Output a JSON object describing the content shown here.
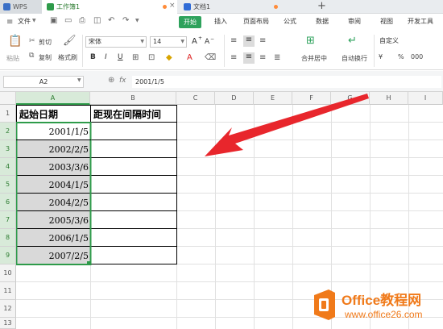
{
  "app": {
    "wps_tab": "WPS",
    "workbook_tab": "工作簿1",
    "doc_tab": "文档1",
    "new_tab_plus": "+"
  },
  "menu": {
    "file": "文件",
    "start": "开始",
    "insert": "插入",
    "page_layout": "页面布局",
    "formula": "公式",
    "data": "数据",
    "review": "审阅",
    "view": "视图",
    "dev_tools": "开发工具"
  },
  "toolbar": {
    "cut": "剪切",
    "copy": "复制",
    "format_painter": "格式刷",
    "paste": "粘贴",
    "font_name": "宋体",
    "font_size": "14",
    "bold": "B",
    "italic": "I",
    "underline": "U",
    "grow_font": "A",
    "shrink_font": "A",
    "merge_center": "合并居中",
    "auto_wrap": "自动换行",
    "number_format": "自定义",
    "currency": "¥",
    "percent": "%",
    "thousands": "000"
  },
  "formula_bar": {
    "name_box": "A2",
    "fx": "fx",
    "value": "2001/1/5"
  },
  "columns": [
    "A",
    "B",
    "C",
    "D",
    "E",
    "F",
    "G",
    "H",
    "I"
  ],
  "rows": [
    "1",
    "2",
    "3",
    "4",
    "5",
    "6",
    "7",
    "8",
    "9",
    "10",
    "11",
    "12",
    "13"
  ],
  "sheet": {
    "header_a": "起始日期",
    "header_b": "距现在间隔时间",
    "dates": [
      "2001/1/5",
      "2002/2/5",
      "2003/3/6",
      "2004/1/5",
      "2004/2/5",
      "2005/3/6",
      "2006/1/5",
      "2007/2/5"
    ]
  },
  "watermark": {
    "brand": "Office教程网",
    "url": "www.office26.com"
  },
  "colors": {
    "green_accent": "#2ea25c",
    "selection_fill": "#d9d9d9",
    "selection_border": "#2e9b4a",
    "arrow": "#e8262c",
    "office_orange": "#f07a1a"
  }
}
